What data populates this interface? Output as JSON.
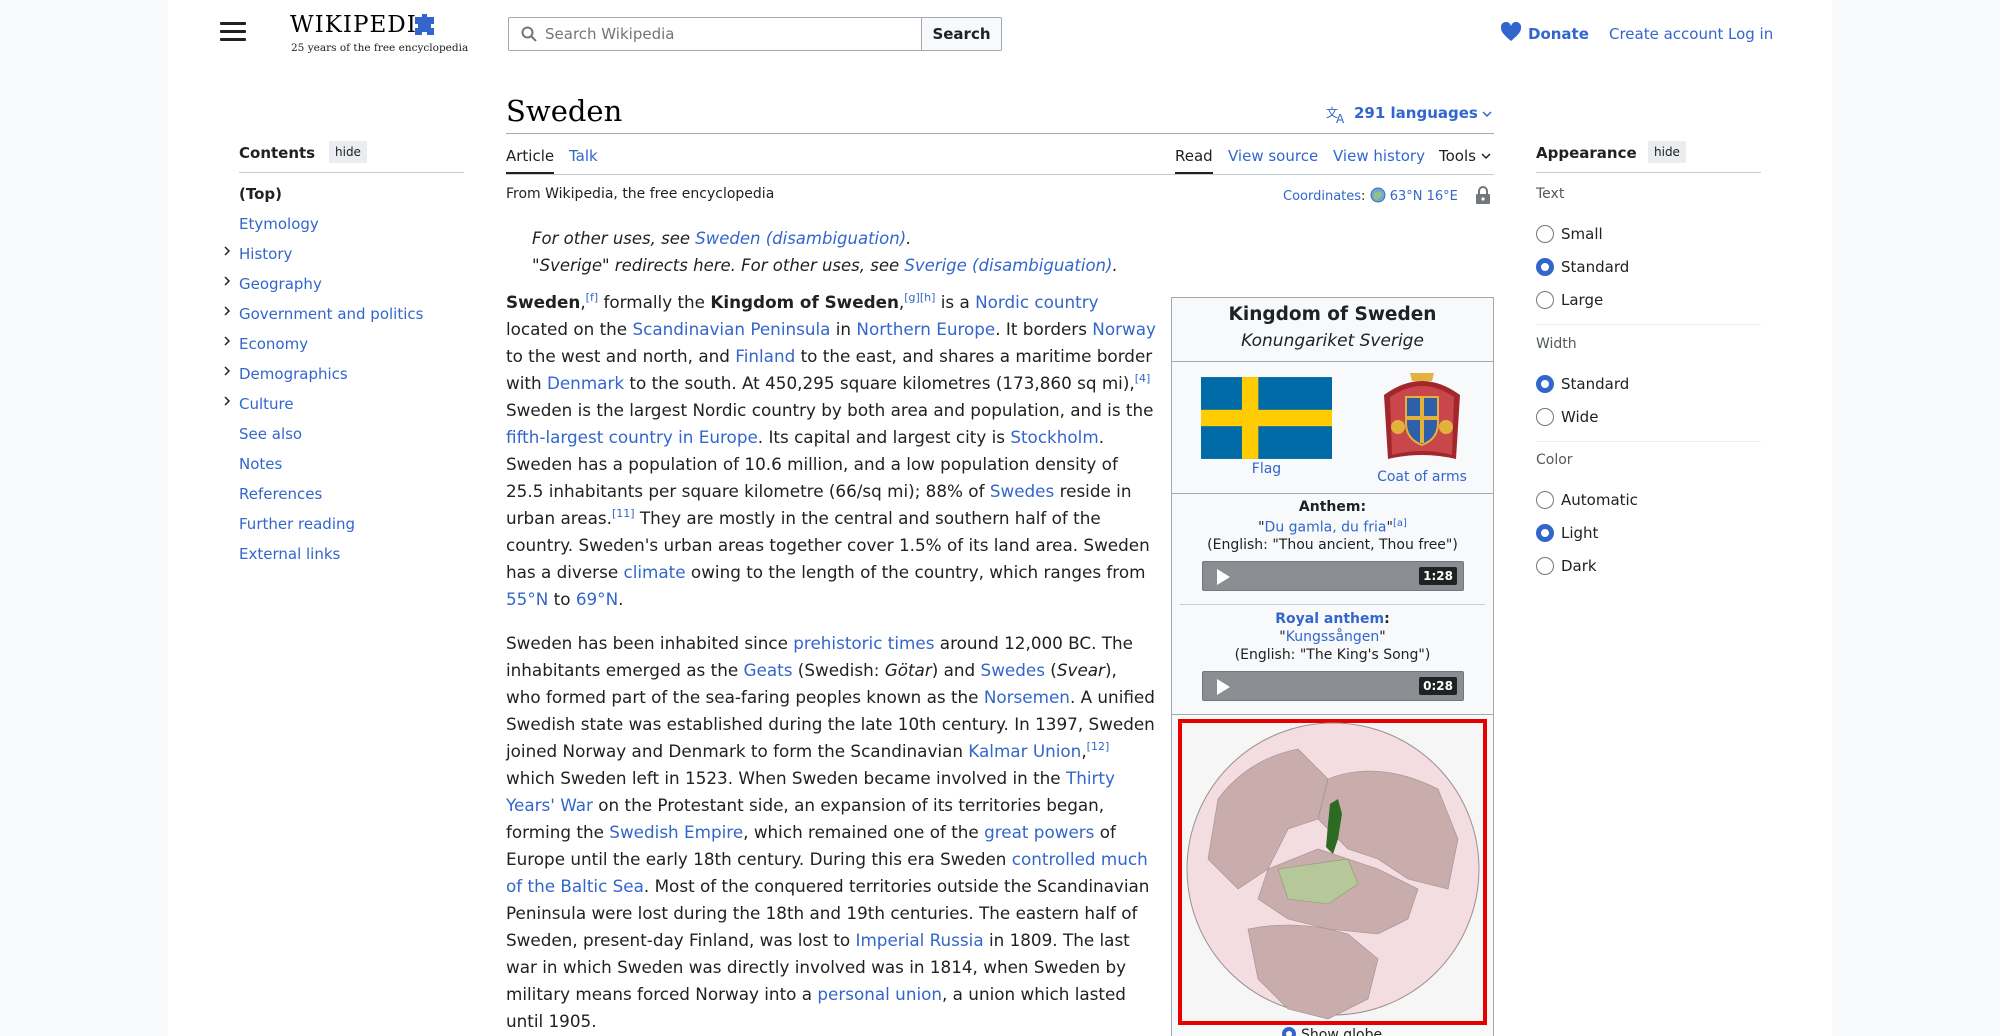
{
  "header": {
    "logo_word": "WIKIPEDIA",
    "logo_tagline": "25 years of the free encyclopedia",
    "search_placeholder": "Search Wikipedia",
    "search_button": "Search",
    "donate": "Donate",
    "create_account": "Create account",
    "log_in": "Log in"
  },
  "toc": {
    "title": "Contents",
    "hide": "hide",
    "items": [
      "(Top)",
      "Etymology",
      "History",
      "Geography",
      "Government and politics",
      "Economy",
      "Demographics",
      "Culture",
      "See also",
      "Notes",
      "References",
      "Further reading",
      "External links"
    ]
  },
  "article": {
    "title": "Sweden",
    "languages": "291 languages",
    "tabs": {
      "article": "Article",
      "talk": "Talk",
      "read": "Read",
      "view_source": "View source",
      "view_history": "View history",
      "tools": "Tools"
    },
    "from": "From Wikipedia, the free encyclopedia",
    "coords_label": "Coordinates",
    "coords_value": "63°N 16°E",
    "hatnote1_pre": "For other uses, see ",
    "hatnote1_link": "Sweden (disambiguation)",
    "hatnote2_pre": "\"Sverige\" redirects here. For other uses, see ",
    "hatnote2_link": "Sverige (disambiguation)",
    "p1": {
      "s1": "Sweden",
      "s2": ",",
      "r1": "[f]",
      "s3": " formally the ",
      "s4": "Kingdom of Sweden",
      "s5": ",",
      "r2": "[g][h]",
      "s6": " is a ",
      "l1": "Nordic country",
      "s7": " located on the ",
      "l2": "Scandinavian Peninsula",
      "s8": " in ",
      "l3": "Northern Europe",
      "s9": ". It borders ",
      "l4": "Norway",
      "s10": " to the west and north, and ",
      "l5": "Finland",
      "s11": " to the east, and shares a maritime border with ",
      "l6": "Denmark",
      "s12": " to the south. At 450,295 square kilometres (173,860 sq mi),",
      "r3": "[4]",
      "s13": " Sweden is the largest Nordic country by both area and population, and is the ",
      "l7": "fifth-largest country in Europe",
      "s14": ". Its capital and largest city is ",
      "l8": "Stockholm",
      "s15": ". Sweden has a population of 10.6 million, and a low population density of 25.5 inhabitants per square kilometre (66/sq mi); 88% of ",
      "l9": "Swedes",
      "s16": " reside in urban areas.",
      "r4": "[11]",
      "s17": " They are mostly in the central and southern half of the country. Sweden's urban areas together cover 1.5% of its land area. Sweden has a diverse ",
      "l10": "climate",
      "s18": " owing to the length of the country, which ranges from ",
      "l11": "55°N",
      "s19": " to ",
      "l12": "69°N",
      "s20": "."
    },
    "p2": {
      "s1": "Sweden has been inhabited since ",
      "l1": "prehistoric times",
      "s2": " around 12,000 BC. The inhabitants emerged as the ",
      "l2": "Geats",
      "s3": " (Swedish: ",
      "i1": "Götar",
      "s4": ") and ",
      "l3": "Swedes",
      "s5": " (",
      "i2": "Svear",
      "s6": "), who formed part of the sea-faring peoples known as the ",
      "l4": "Norsemen",
      "s7": ". A unified Swedish state was established during the late 10th century. In 1397, Sweden joined Norway and Denmark to form the Scandinavian ",
      "l5": "Kalmar Union",
      "s8": ",",
      "r1": "[12]",
      "s9": " which Sweden left in 1523. When Sweden became involved in the ",
      "l6": "Thirty Years' War",
      "s10": " on the Protestant side, an expansion of its territories began, forming the ",
      "l7": "Swedish Empire",
      "s11": ", which remained one of the ",
      "l8": "great powers",
      "s12": " of Europe until the early 18th century. During this era Sweden ",
      "l9": "controlled much of the Baltic Sea",
      "s13": ". Most of the conquered territories outside the Scandinavian Peninsula were lost during the 18th and 19th centuries. The eastern half of Sweden, present-day Finland, was lost to ",
      "l10": "Imperial Russia",
      "s14": " in 1809. The last war in which Sweden was directly involved was in 1814, when Sweden by military means forced Norway into a ",
      "l11": "personal union",
      "s15": ", a union which lasted until 1905."
    }
  },
  "infobox": {
    "title": "Kingdom of Sweden",
    "native": "Konungariket Sverige",
    "flag_caption": "Flag",
    "coa_caption": "Coat of arms",
    "anthem_label": "Anthem:",
    "anthem_name": "Du gamla, du fria",
    "anthem_ref": "[a]",
    "anthem_english": "(English: \"Thou ancient, Thou free\")",
    "anthem_duration": "1:28",
    "royal_label": "Royal anthem",
    "royal_name": "Kungssången",
    "royal_english": "(English: \"The King's Song\")",
    "royal_duration": "0:28",
    "show_globe": "Show globe",
    "colors": {
      "flag_blue": "#006aa7",
      "flag_yellow": "#fecc00",
      "map_frame": "#e60000"
    }
  },
  "appearance": {
    "title": "Appearance",
    "hide": "hide",
    "text_label": "Text",
    "text_options": [
      "Small",
      "Standard",
      "Large"
    ],
    "text_selected": "Standard",
    "width_label": "Width",
    "width_options": [
      "Standard",
      "Wide"
    ],
    "width_selected": "Standard",
    "color_label": "Color",
    "color_options": [
      "Automatic",
      "Light",
      "Dark"
    ],
    "color_selected": "Light"
  }
}
